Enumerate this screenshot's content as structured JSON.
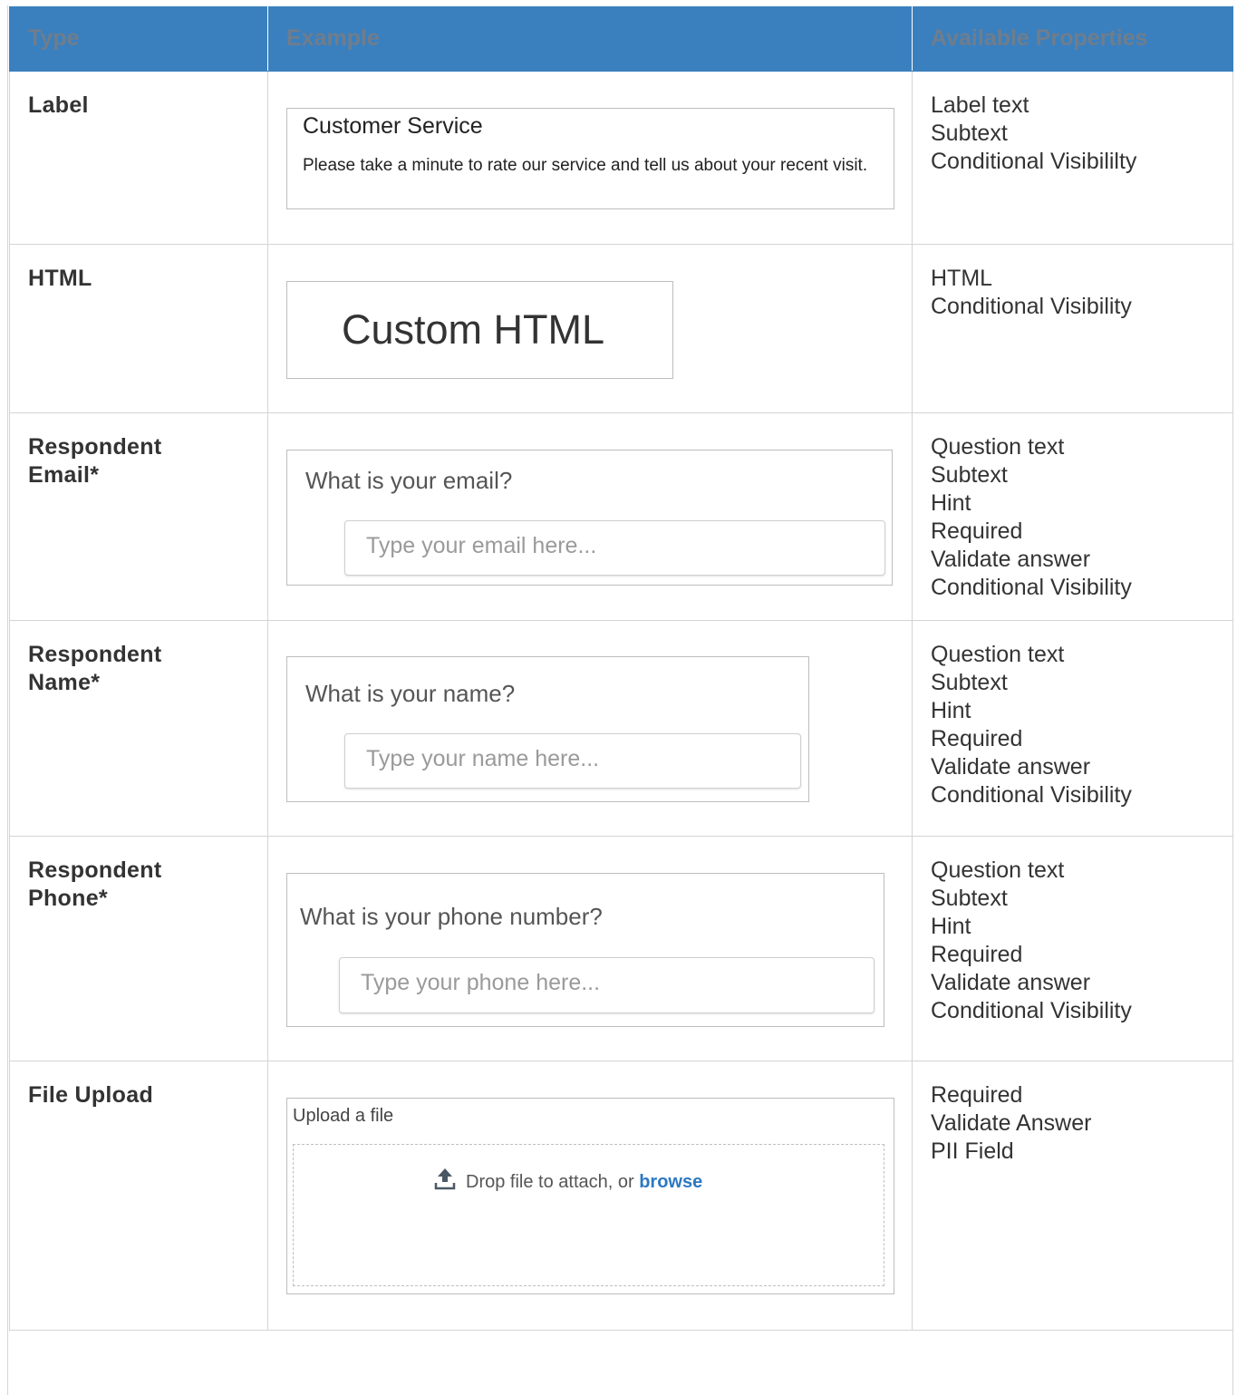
{
  "header": {
    "col_type": "Type",
    "col_example": "Example",
    "col_properties": "Available Properties"
  },
  "rows": [
    {
      "type": "Label",
      "example": {
        "title": "Customer Service",
        "subtext": "Please take a minute to rate our service and tell us about your recent visit."
      },
      "properties": [
        "Label text",
        "Subtext",
        "Conditional Visibililty"
      ]
    },
    {
      "type": "HTML",
      "example": {
        "text": "Custom HTML"
      },
      "properties": [
        "HTML",
        "Conditional Visibility"
      ]
    },
    {
      "type_line1": "Respondent",
      "type_line2": "Email*",
      "example": {
        "question": "What is your email?",
        "placeholder": "Type your email here..."
      },
      "properties": [
        "Question text",
        "Subtext",
        "Hint",
        "Required",
        "Validate answer",
        "Conditional Visibility"
      ]
    },
    {
      "type_line1": "Respondent",
      "type_line2": "Name*",
      "example": {
        "question": "What is your name?",
        "placeholder": "Type your name here..."
      },
      "properties": [
        "Question text",
        "Subtext",
        "Hint",
        "Required",
        "Validate answer",
        "Conditional Visibility"
      ]
    },
    {
      "type_line1": "Respondent",
      "type_line2": "Phone*",
      "example": {
        "question": "What is your phone number?",
        "placeholder": "Type your phone here..."
      },
      "properties": [
        "Question text",
        "Subtext",
        "Hint",
        "Required",
        "Validate answer",
        "Conditional Visibility"
      ]
    },
    {
      "type": "File Upload",
      "example": {
        "label": "Upload a file",
        "drop_text": "Drop file to attach, or",
        "browse_text": "browse"
      },
      "properties": [
        "Required",
        "Validate Answer",
        "PII Field"
      ]
    }
  ],
  "colors": {
    "header_bg": "#3a80bf",
    "header_text": "#6f7d8c",
    "link": "#2c78c2",
    "border": "#d4d4d4"
  },
  "icons": {
    "upload": "upload-arrow-icon"
  }
}
